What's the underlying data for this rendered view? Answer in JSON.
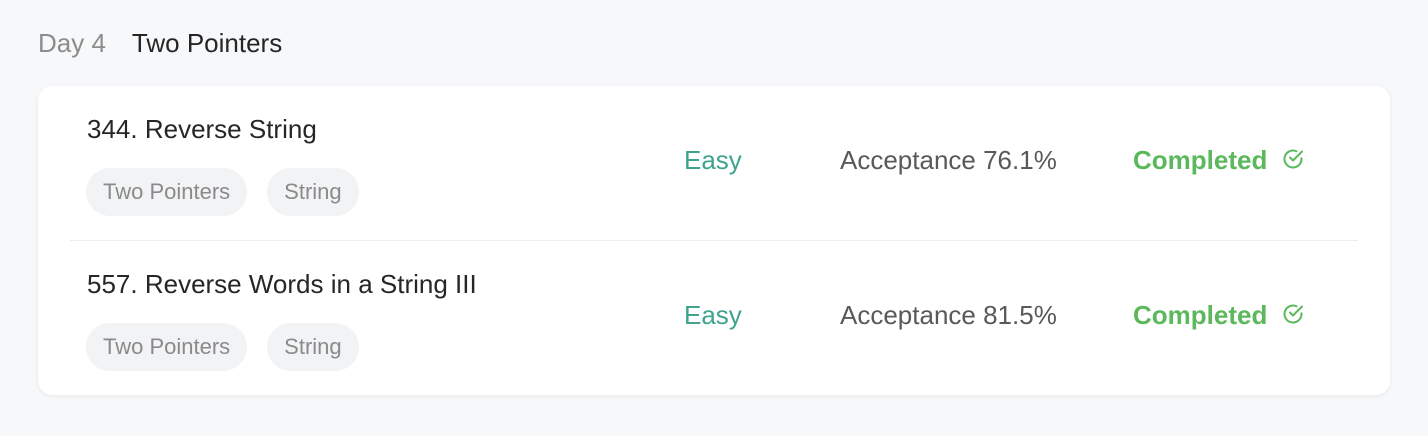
{
  "section": {
    "day_label": "Day 4",
    "title": "Two Pointers"
  },
  "problems": [
    {
      "title": "344. Reverse String",
      "tags": [
        "Two Pointers",
        "String"
      ],
      "difficulty": "Easy",
      "acceptance": "Acceptance 76.1%",
      "status": "Completed",
      "status_icon": "check-circle-icon"
    },
    {
      "title": "557. Reverse Words in a String III",
      "tags": [
        "Two Pointers",
        "String"
      ],
      "difficulty": "Easy",
      "acceptance": "Acceptance 81.5%",
      "status": "Completed",
      "status_icon": "check-circle-icon"
    }
  ],
  "colors": {
    "easy": "#3fa38d",
    "completed": "#5cb85c",
    "tag_bg": "#f2f3f5"
  }
}
